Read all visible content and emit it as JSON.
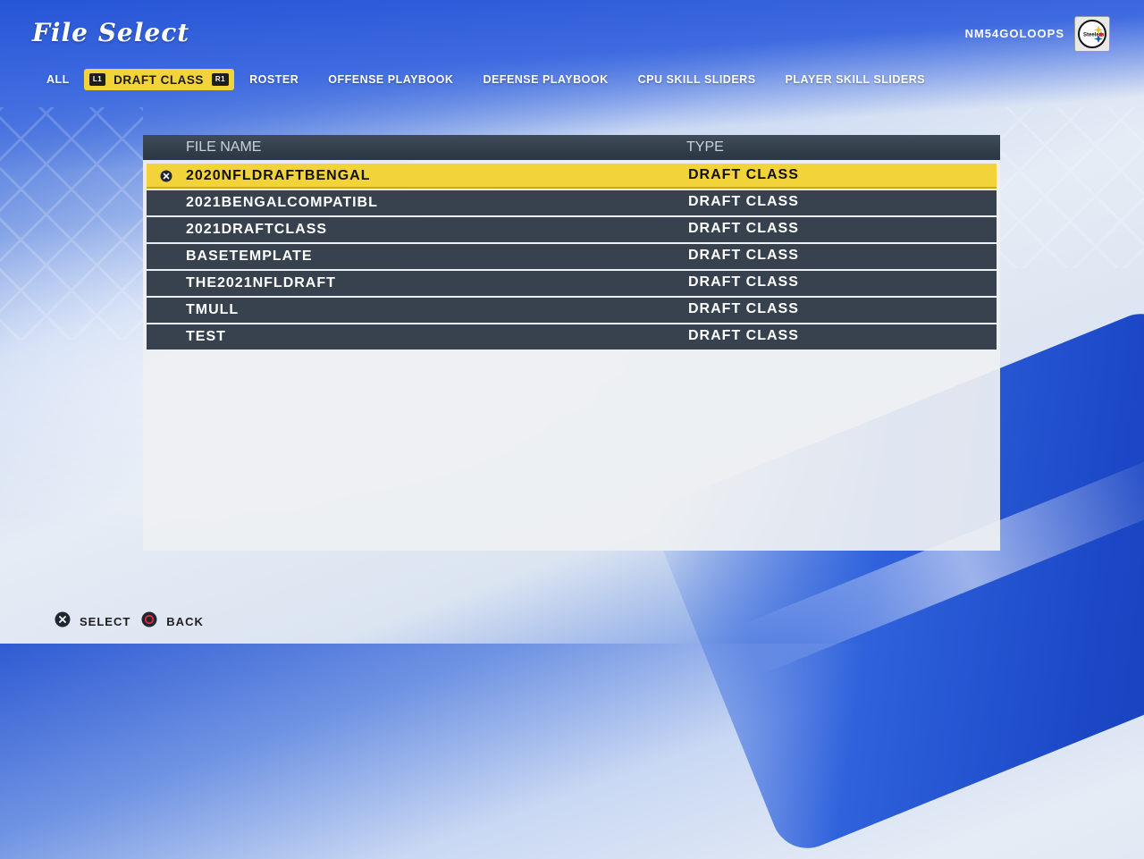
{
  "header": {
    "title": "File Select",
    "username": "NM54GOLOOPS",
    "team_logo_icon": "steelers-logo-icon",
    "team_logo_text": "Steelers"
  },
  "tabs": [
    {
      "label": "ALL",
      "active": false
    },
    {
      "label": "DRAFT CLASS",
      "active": true,
      "left_bumper": "L1",
      "right_bumper": "R1"
    },
    {
      "label": "ROSTER",
      "active": false
    },
    {
      "label": "OFFENSE PLAYBOOK",
      "active": false
    },
    {
      "label": "DEFENSE PLAYBOOK",
      "active": false
    },
    {
      "label": "CPU SKILL SLIDERS",
      "active": false
    },
    {
      "label": "PLAYER SKILL SLIDERS",
      "active": false
    }
  ],
  "table": {
    "columns": [
      "FILE NAME",
      "TYPE"
    ],
    "rows": [
      {
        "name": "2020NFLDRAFTBENGAL",
        "type": "DRAFT CLASS",
        "selected": true
      },
      {
        "name": "2021BENGALCOMPATIBL",
        "type": "DRAFT CLASS",
        "selected": false
      },
      {
        "name": "2021DRAFTCLASS",
        "type": "DRAFT CLASS",
        "selected": false
      },
      {
        "name": "BASETEMPLATE",
        "type": "DRAFT CLASS",
        "selected": false
      },
      {
        "name": "THE2021NFLDRAFT",
        "type": "DRAFT CLASS",
        "selected": false
      },
      {
        "name": "TMULL",
        "type": "DRAFT CLASS",
        "selected": false
      },
      {
        "name": "TEST",
        "type": "DRAFT CLASS",
        "selected": false
      }
    ]
  },
  "footer": {
    "select_label": "SELECT",
    "select_icon": "cross-button-icon",
    "back_label": "BACK",
    "back_icon": "circle-button-icon"
  },
  "colors": {
    "accent_yellow": "#f2d43a",
    "row_dark": "#37424e",
    "header_dark": "#2c3642",
    "brand_blue": "#1f4ed3",
    "circle_button_red": "#e0293a"
  }
}
